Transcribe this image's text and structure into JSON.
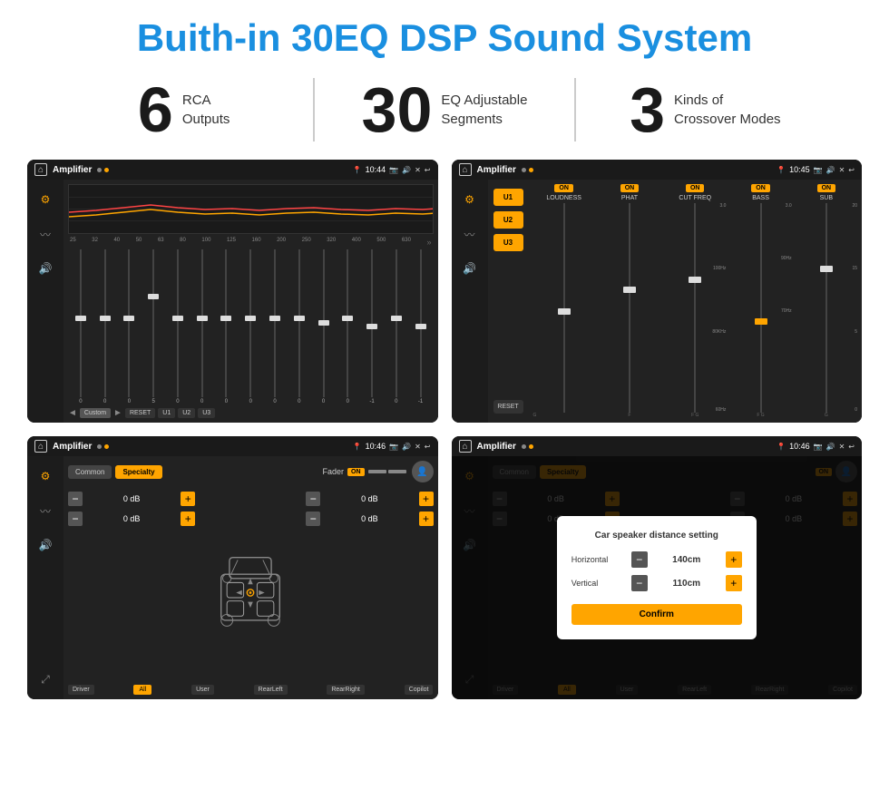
{
  "page": {
    "title": "Buith-in 30EQ DSP Sound System"
  },
  "stats": [
    {
      "number": "6",
      "text_line1": "RCA",
      "text_line2": "Outputs"
    },
    {
      "number": "30",
      "text_line1": "EQ Adjustable",
      "text_line2": "Segments"
    },
    {
      "number": "3",
      "text_line1": "Kinds of",
      "text_line2": "Crossover Modes"
    }
  ],
  "screens": [
    {
      "id": "eq-screen",
      "time": "10:44",
      "app": "Amplifier",
      "desc": "30-band EQ screen"
    },
    {
      "id": "crossover-screen",
      "time": "10:45",
      "app": "Amplifier",
      "desc": "Crossover modes screen"
    },
    {
      "id": "fader-screen",
      "time": "10:46",
      "app": "Amplifier",
      "desc": "Fader control screen"
    },
    {
      "id": "dialog-screen",
      "time": "10:46",
      "app": "Amplifier",
      "desc": "Speaker distance dialog"
    }
  ],
  "eq": {
    "frequencies": [
      "25",
      "32",
      "40",
      "50",
      "63",
      "80",
      "100",
      "125",
      "160",
      "200",
      "250",
      "320",
      "400",
      "500",
      "630"
    ],
    "values": [
      "0",
      "0",
      "0",
      "5",
      "0",
      "0",
      "0",
      "0",
      "0",
      "0",
      "-1",
      "0",
      "-1"
    ],
    "presets": [
      "Custom",
      "RESET",
      "U1",
      "U2",
      "U3"
    ],
    "slider_positions": [
      50,
      50,
      50,
      35,
      50,
      50,
      50,
      50,
      50,
      50,
      55,
      50,
      55
    ]
  },
  "crossover": {
    "presets": [
      "U1",
      "U2",
      "U3"
    ],
    "channels": [
      {
        "label": "LOUDNESS",
        "on": true
      },
      {
        "label": "PHAT",
        "on": true
      },
      {
        "label": "CUT FREQ",
        "on": true
      },
      {
        "label": "BASS",
        "on": true
      },
      {
        "label": "SUB",
        "on": true
      }
    ]
  },
  "fader": {
    "tabs": [
      "Common",
      "Specialty"
    ],
    "active_tab": "Specialty",
    "label": "Fader",
    "on": true,
    "channels": [
      {
        "label": "0 dB"
      },
      {
        "label": "0 dB"
      },
      {
        "label": "0 dB"
      },
      {
        "label": "0 dB"
      }
    ],
    "bottom_labels": [
      "Driver",
      "All",
      "User",
      "RearLeft",
      "RearRight",
      "Copilot"
    ]
  },
  "dialog": {
    "title": "Car speaker distance setting",
    "horizontal_label": "Horizontal",
    "horizontal_value": "140cm",
    "vertical_label": "Vertical",
    "vertical_value": "110cm",
    "confirm_label": "Confirm"
  }
}
